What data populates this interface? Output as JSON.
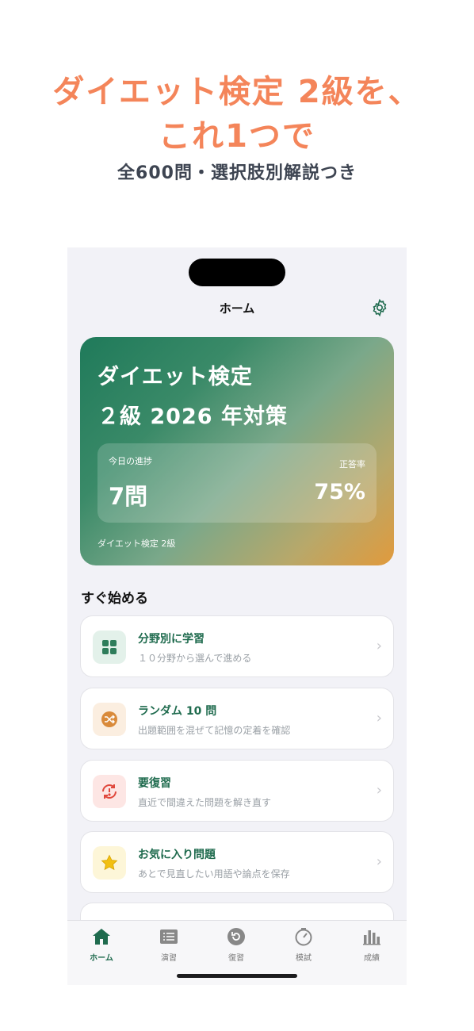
{
  "promo": {
    "headline_line1": "ダイエット検定 2級を、",
    "headline_line2": "これ1つで",
    "subheadline": "全600問・選択肢別解説つき"
  },
  "nav": {
    "title": "ホーム",
    "settings_icon": "gear-icon"
  },
  "hero": {
    "title_line1": "ダイエット検定",
    "title_line2": "２級 2026 年対策",
    "progress_label": "今日の進捗",
    "progress_value": "7問",
    "accuracy_label": "正答率",
    "accuracy_value": "75%",
    "footer": "ダイエット検定 2級"
  },
  "section": {
    "title": "すぐ始める"
  },
  "cards": [
    {
      "title": "分野別に学習",
      "subtitle": "１０分野から選んで進める",
      "icon": "grid-icon",
      "color": "#2e7d5b"
    },
    {
      "title": "ランダム 10 問",
      "subtitle": "出題範囲を混ぜて記憶の定着を確認",
      "icon": "shuffle-icon",
      "color": "#d98a3a"
    },
    {
      "title": "要復習",
      "subtitle": "直近で間違えた問題を解き直す",
      "icon": "review-alert-icon",
      "color": "#e0483c"
    },
    {
      "title": "お気に入り問題",
      "subtitle": "あとで見直したい用語や論点を保存",
      "icon": "star-icon",
      "color": "#f2c012"
    }
  ],
  "tabs": [
    {
      "label": "ホーム",
      "icon": "home-icon",
      "active": true
    },
    {
      "label": "演習",
      "icon": "list-icon",
      "active": false
    },
    {
      "label": "復習",
      "icon": "review-icon",
      "active": false
    },
    {
      "label": "模試",
      "icon": "timer-icon",
      "active": false
    },
    {
      "label": "成績",
      "icon": "bar-chart-icon",
      "active": false
    }
  ],
  "colors": {
    "accent": "#1f6b4e",
    "promo": "#f4855a",
    "background": "#f2f2f7"
  }
}
